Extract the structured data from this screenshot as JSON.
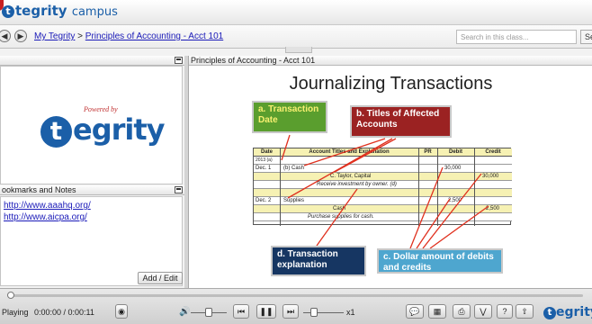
{
  "app": {
    "brand": "tegrity",
    "brand_suffix": "campus"
  },
  "nav": {
    "back_icon": "back-arrow-icon",
    "forward_icon": "forward-arrow-icon",
    "breadcrumb_home": "My Tegrity",
    "breadcrumb_sep": ">",
    "breadcrumb_course": "Principles of Accounting - Acct 101",
    "search_placeholder": "Search in this class...",
    "search_button": "Sea"
  },
  "left": {
    "video_logo_powered": "Powered by",
    "video_logo_word": "egrity",
    "video_logo_letter": "t",
    "bookmarks_title": "ookmarks and Notes",
    "links": [
      "http://www.aaahq.org/",
      "http://www.aicpa.org/"
    ],
    "add_edit": "Add / Edit"
  },
  "slide": {
    "pane_title": "Principles of Accounting - Acct 101",
    "title": "Journalizing Transactions",
    "callout_a": "a.  Transaction Date",
    "callout_b": "b.  Titles of Affected Accounts",
    "callout_d": "d.  Transaction explanation",
    "callout_c": "c.  Dollar amount of debits and credits",
    "ledger": {
      "headers": [
        "Date",
        "Account Titles and Explanation",
        "PR",
        "Debit",
        "Credit"
      ],
      "rows": [
        {
          "date": "2013 (a)",
          "title": "",
          "pr": "",
          "debit": "",
          "credit": ""
        },
        {
          "date": "Dec. 1",
          "title": "(b)   Cash",
          "pr": "",
          "debit": "30,000",
          "credit": ""
        },
        {
          "date": "",
          "title": "C. Taylor, Capital",
          "pr": "",
          "debit": "",
          "credit": "30,000"
        },
        {
          "date": "",
          "title": "Receive investment by owner.  (d)",
          "pr": "",
          "debit": "",
          "credit": ""
        },
        {
          "date": "",
          "title": "",
          "pr": "",
          "debit": "",
          "credit": ""
        },
        {
          "date": "Dec. 2",
          "title": "Supplies",
          "pr": "",
          "debit": "2,500",
          "credit": ""
        },
        {
          "date": "",
          "title": "Cash",
          "pr": "",
          "debit": "",
          "credit": "2,500"
        },
        {
          "date": "",
          "title": "Purchase supplies for cash.",
          "pr": "",
          "debit": "",
          "credit": ""
        }
      ]
    }
  },
  "player": {
    "state": "Playing",
    "time": "0:00:00 / 0:00:11",
    "speed": "x1",
    "progress_fraction": 0.0,
    "icons": [
      "record-icon",
      "volume-icon",
      "skip-back-icon",
      "pause-icon",
      "skip-forward-icon",
      "speed-icon",
      "chat-icon",
      "thumbnails-icon",
      "print-icon",
      "collapse-icon",
      "help-icon",
      "upload-icon"
    ],
    "brand": "egrity",
    "brand_letter": "t"
  },
  "colors": {
    "brand_blue": "#1b5fa8",
    "callout_a": "#5a9e2e",
    "callout_b": "#9b2222",
    "callout_d": "#163662",
    "callout_c": "#4ea6cf"
  }
}
